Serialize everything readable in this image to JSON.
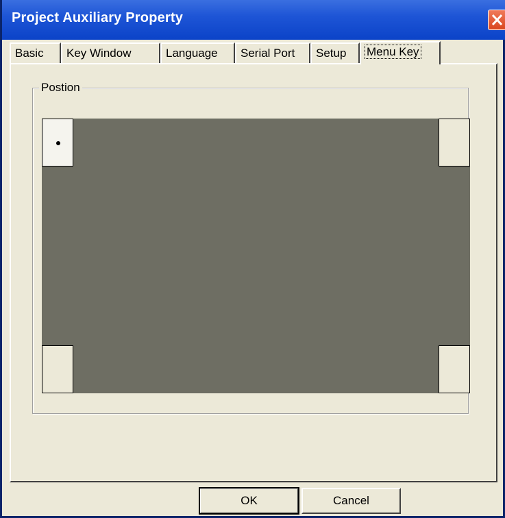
{
  "window": {
    "title": "Project Auxiliary Property"
  },
  "tabs": [
    {
      "label": "Basic",
      "active": false
    },
    {
      "label": "Key Window",
      "active": false
    },
    {
      "label": "Language",
      "active": false
    },
    {
      "label": "Serial Port",
      "active": false
    },
    {
      "label": "Setup",
      "active": false
    },
    {
      "label": "Menu Key",
      "active": true
    }
  ],
  "position_group": {
    "label": "Postion",
    "selected_corner": "top-left",
    "corners": [
      "top-left",
      "top-right",
      "bottom-left",
      "bottom-right"
    ]
  },
  "buttons": {
    "ok": "OK",
    "cancel": "Cancel"
  },
  "colors": {
    "title_bar": "#0b43c8",
    "screen_area": "#6e6e63",
    "dialog_bg": "#ece9d8",
    "close_button": "#d9461f"
  },
  "icons": {
    "close": "close-x-icon",
    "selection": "radio-dot-icon"
  }
}
